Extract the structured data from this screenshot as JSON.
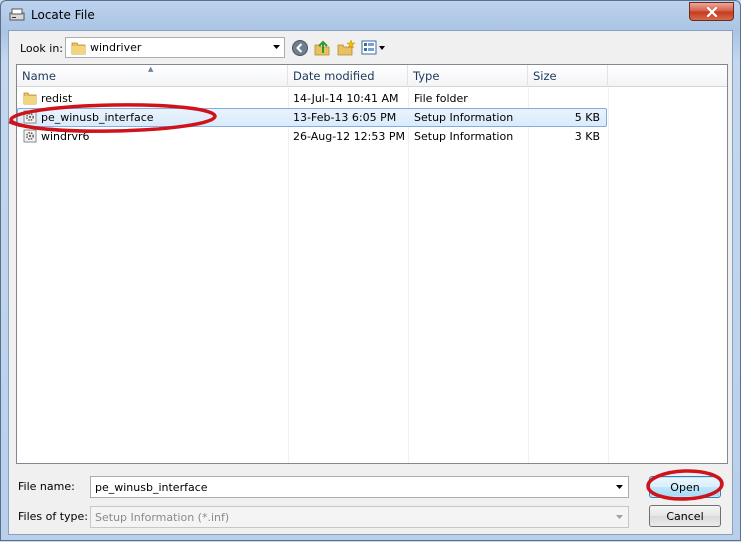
{
  "window": {
    "title": "Locate File"
  },
  "toolbar": {
    "look_in_label": "Look in:",
    "look_in_value": "windriver"
  },
  "columns": {
    "name": "Name",
    "date": "Date modified",
    "type": "Type",
    "size": "Size"
  },
  "files": [
    {
      "name": "redist",
      "date": "14-Jul-14 10:41 AM",
      "type": "File folder",
      "size": "",
      "icon": "folder-icon"
    },
    {
      "name": "pe_winusb_interface",
      "date": "13-Feb-13 6:05 PM",
      "type": "Setup Information",
      "size": "5 KB",
      "icon": "setup-file-icon",
      "selected": true
    },
    {
      "name": "windrvr6",
      "date": "26-Aug-12 12:53 PM",
      "type": "Setup Information",
      "size": "3 KB",
      "icon": "setup-file-icon"
    }
  ],
  "footer": {
    "file_name_label": "File name:",
    "file_name_value": "pe_winusb_interface",
    "file_type_label": "Files of type:",
    "file_type_value": "Setup Information (*.inf)",
    "open_label": "Open",
    "cancel_label": "Cancel"
  },
  "colors": {
    "annotation": "#d0121b",
    "selection_border": "#84acdd",
    "close_button": "#c43a1e"
  }
}
